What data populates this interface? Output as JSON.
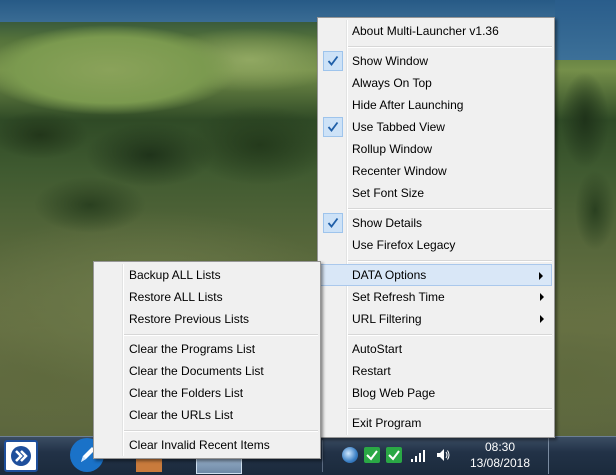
{
  "main_menu": {
    "items": [
      {
        "label": "About Multi-Launcher v1.36"
      },
      {
        "label": "Show Window",
        "checked": true
      },
      {
        "label": "Always On Top"
      },
      {
        "label": "Hide After Launching"
      },
      {
        "label": "Use Tabbed View",
        "checked": true
      },
      {
        "label": "Rollup Window"
      },
      {
        "label": "Recenter Window"
      },
      {
        "label": "Set Font Size"
      },
      {
        "label": "Show Details",
        "checked": true
      },
      {
        "label": "Use Firefox Legacy"
      },
      {
        "label": "DATA Options",
        "submenu": true,
        "highlighted": true
      },
      {
        "label": "Set Refresh Time",
        "submenu": true
      },
      {
        "label": "URL Filtering",
        "submenu": true
      },
      {
        "label": "AutoStart"
      },
      {
        "label": "Restart"
      },
      {
        "label": "Blog Web Page"
      },
      {
        "label": "Exit Program"
      }
    ]
  },
  "data_options_submenu": {
    "items": [
      {
        "label": "Backup ALL Lists"
      },
      {
        "label": "Restore ALL Lists"
      },
      {
        "label": "Restore Previous Lists"
      },
      {
        "label": "Clear the Programs List"
      },
      {
        "label": "Clear the Documents List"
      },
      {
        "label": "Clear the Folders List"
      },
      {
        "label": "Clear the URLs List"
      },
      {
        "label": "Clear Invalid Recent Items"
      }
    ]
  },
  "taskbar": {
    "clock_time": "08:30",
    "clock_date": "13/08/2018"
  },
  "colors": {
    "menu_bg": "#f0f0f0",
    "highlight": "#d9e7f7",
    "check_blue": "#1f5fa8",
    "taskbar": "#1b2a3c"
  }
}
